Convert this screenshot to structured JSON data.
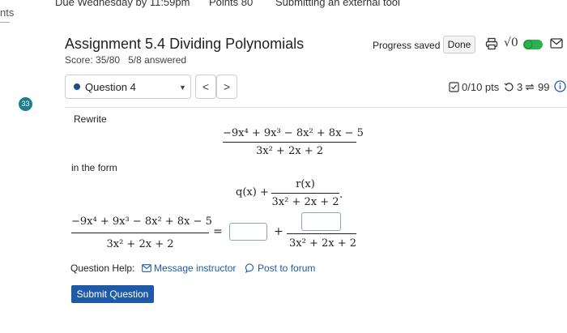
{
  "topbar": {
    "nav_fragment": "nts",
    "due": "Due  Wednesday by 11:59pm",
    "points": "Points  80",
    "submitting": "Submitting  an external tool"
  },
  "assignment": {
    "title": "Assignment 5.4 Dividing Polynomials",
    "score": "Score: 35/80",
    "answered": "5/8 answered"
  },
  "header_actions": {
    "progress_status": "Progress saved",
    "done_label": "Done",
    "sqrt_label": "√0"
  },
  "question_nav": {
    "selected": "Question 4",
    "prev": "<",
    "next": ">",
    "points": "0/10 pts",
    "attempts": "3",
    "retries": "99",
    "badge_number": "33"
  },
  "problem": {
    "rewrite_label": "Rewrite",
    "numerator": "−9x⁴ + 9x³ − 8x² + 8x − 5",
    "denominator": "3x² + 2x + 2",
    "in_the_form": "in the form",
    "form_prefix": "q(x) +",
    "form_num": "r(x)",
    "form_den": "3x² + 2x + 2",
    "form_suffix": ".",
    "eq_sign": "=",
    "plus_sign": "+"
  },
  "help": {
    "label": "Question Help:",
    "message": "Message instructor",
    "post": "Post to forum"
  },
  "submit": {
    "label": "Submit Question"
  },
  "colors": {
    "accent": "#1e5aa8",
    "progress_red": "#c2272d",
    "toggle_green": "#2bb24c",
    "badge_teal": "#1b7f8f"
  },
  "icons": {
    "print": "printer-icon",
    "toggle": "toggle-icon",
    "mail": "mail-icon",
    "checkbox": "checkbox-icon",
    "retry": "retry-icon",
    "sync": "sync-icon",
    "info": "info-icon",
    "forum": "speech-bubble-icon"
  }
}
